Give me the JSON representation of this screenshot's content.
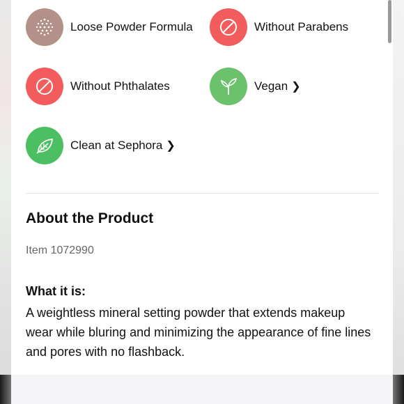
{
  "highlights": [
    {
      "label": "Loose Powder Formula",
      "icon": "powder-dots-icon",
      "color": "#b39189",
      "has_link": false
    },
    {
      "label": "Without Parabens",
      "icon": "prohibited-icon",
      "color": "#f25c5c",
      "has_link": false
    },
    {
      "label": "Without Phthalates",
      "icon": "prohibited-icon",
      "color": "#f25c5c",
      "has_link": false
    },
    {
      "label": "Vegan",
      "icon": "sprout-icon",
      "color": "#6cc16c",
      "has_link": true
    },
    {
      "label": "Clean at Sephora",
      "icon": "leaf-icon",
      "color": "#4cbf62",
      "has_link": true
    }
  ],
  "about": {
    "title": "About the Product",
    "item_number": "Item 1072990",
    "what_it_is_title": "What it is:",
    "what_it_is_body": "A weightless mineral setting powder that extends makeup wear while bluring and minimizing the appearance of fine lines and pores with no flashback."
  }
}
